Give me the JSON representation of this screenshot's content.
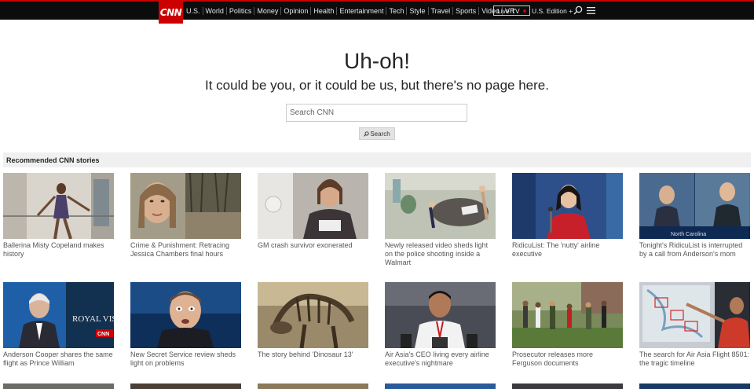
{
  "header": {
    "logo_text": "CNN",
    "nav_items": [
      "U.S.",
      "World",
      "Politics",
      "Money",
      "Opinion",
      "Health",
      "Entertainment",
      "Tech",
      "Style",
      "Travel",
      "Sports",
      "Video",
      "VR"
    ],
    "live_tv": "Live TV",
    "edition": "U.S. Edition +"
  },
  "hero": {
    "title": "Uh-oh!",
    "subtitle": "It could be you, or it could be us, but there's no page here.",
    "search_placeholder": "Search CNN",
    "search_button": "Search"
  },
  "recommended": {
    "heading": "Recommended CNN stories",
    "stories": [
      {
        "caption": "Ballerina Misty Copeland makes history"
      },
      {
        "caption": "Crime & Punishment: Retracing Jessica Chambers final hours"
      },
      {
        "caption": "GM crash survivor exonerated"
      },
      {
        "caption": "Newly released video sheds light on the police shooting inside a Walmart"
      },
      {
        "caption": "RidicuList: The 'nutty' airline executive"
      },
      {
        "caption": "Tonight's RidicuList is interrupted by a call from Anderson's mom"
      },
      {
        "caption": "Anderson Cooper shares the same flight as Prince William"
      },
      {
        "caption": "New Secret Service review sheds light on problems"
      },
      {
        "caption": "The story behind 'Dinosaur 13'"
      },
      {
        "caption": "Air Asia's CEO living every airline executive's nightmare"
      },
      {
        "caption": "Prosecutor releases more Ferguson documents"
      },
      {
        "caption": "The search for Air Asia Flight 8501: the tragic timeline"
      }
    ]
  },
  "thumb_text": {
    "royal_visit": "ROYAL VISIT",
    "cnn_bug": "CNN",
    "north_carolina": "North Carolina"
  },
  "colors": {
    "brand_red": "#cc0000",
    "nav_bg": "#0c0c0c"
  }
}
